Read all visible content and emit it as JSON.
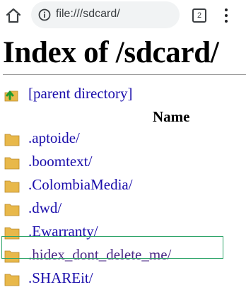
{
  "browser": {
    "url": "file:///sdcard/",
    "tab_count": "2",
    "icons": {
      "home": "home-icon",
      "info": "info-icon",
      "tabs": "tab-switcher-icon",
      "menu": "more-vert-icon"
    }
  },
  "page": {
    "title": "Index of /sdcard/",
    "parent_link": "[parent directory]",
    "column_header": "Name",
    "entries": [
      ".aptoide/",
      ".boomtext/",
      ".ColombiaMedia/",
      ".dwd/",
      ".Ewarranty/",
      ".hidex_dont_delete_me/",
      ".SHAREit/"
    ],
    "highlighted_entry": ".hidex_dont_delete_me/"
  },
  "colors": {
    "link": "#1a0dab",
    "visited_link": "#4b2a86",
    "highlight_border": "#2fa56a",
    "folder": "#e8b84a"
  }
}
